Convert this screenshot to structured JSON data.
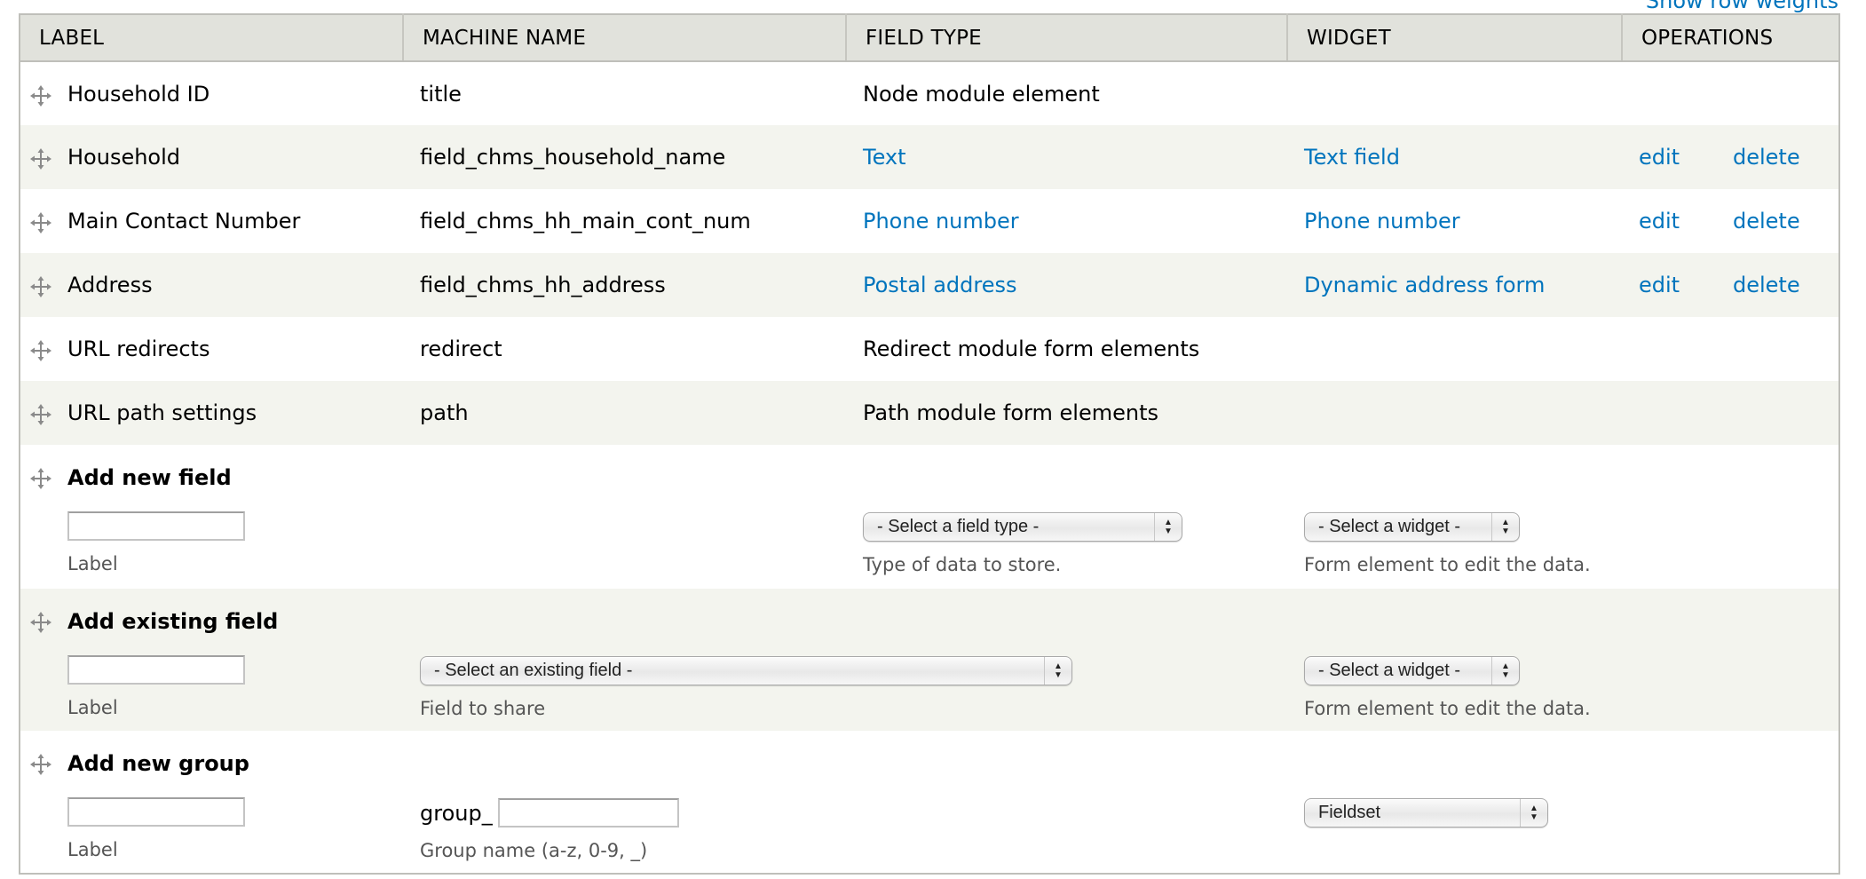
{
  "top_link": {
    "label": "Show row weights",
    "color": "#0074bd"
  },
  "columns": [
    "LABEL",
    "MACHINE NAME",
    "FIELD TYPE",
    "WIDGET",
    "OPERATIONS"
  ],
  "rows": [
    {
      "label": "Household ID",
      "machine_name": "title",
      "field_type": "Node module element",
      "field_type_link": false,
      "widget": "",
      "edit": "",
      "delete": ""
    },
    {
      "label": "Household",
      "machine_name": "field_chms_household_name",
      "field_type": "Text",
      "field_type_link": true,
      "widget": "Text field",
      "edit": "edit",
      "delete": "delete"
    },
    {
      "label": "Main Contact Number",
      "machine_name": "field_chms_hh_main_cont_num",
      "field_type": "Phone number",
      "field_type_link": true,
      "widget": "Phone number",
      "edit": "edit",
      "delete": "delete"
    },
    {
      "label": "Address",
      "machine_name": "field_chms_hh_address",
      "field_type": "Postal address",
      "field_type_link": true,
      "widget": "Dynamic address form",
      "edit": "edit",
      "delete": "delete"
    },
    {
      "label": "URL redirects",
      "machine_name": "redirect",
      "field_type": "Redirect module form elements",
      "field_type_link": false,
      "widget": "",
      "edit": "",
      "delete": ""
    },
    {
      "label": "URL path settings",
      "machine_name": "path",
      "field_type": "Path module form elements",
      "field_type_link": false,
      "widget": "",
      "edit": "",
      "delete": ""
    }
  ],
  "add_new_field": {
    "title": "Add new field",
    "label_value": "",
    "label_desc": "Label",
    "field_type_select": "- Select a field type -",
    "field_type_desc": "Type of data to store.",
    "widget_select": "- Select a widget -",
    "widget_desc": "Form element to edit the data."
  },
  "add_existing_field": {
    "title": "Add existing field",
    "label_value": "",
    "label_desc": "Label",
    "existing_select": "- Select an existing field -",
    "existing_desc": "Field to share",
    "widget_select": "- Select a widget -",
    "widget_desc": "Form element to edit the data."
  },
  "add_new_group": {
    "title": "Add new group",
    "label_value": "",
    "label_desc": "Label",
    "group_prefix": "group_",
    "group_name_value": "",
    "group_desc": "Group name (a-z, 0-9, _)",
    "format_select": "Fieldset"
  },
  "icons": {
    "drag_handle": "move-cross-arrows"
  }
}
